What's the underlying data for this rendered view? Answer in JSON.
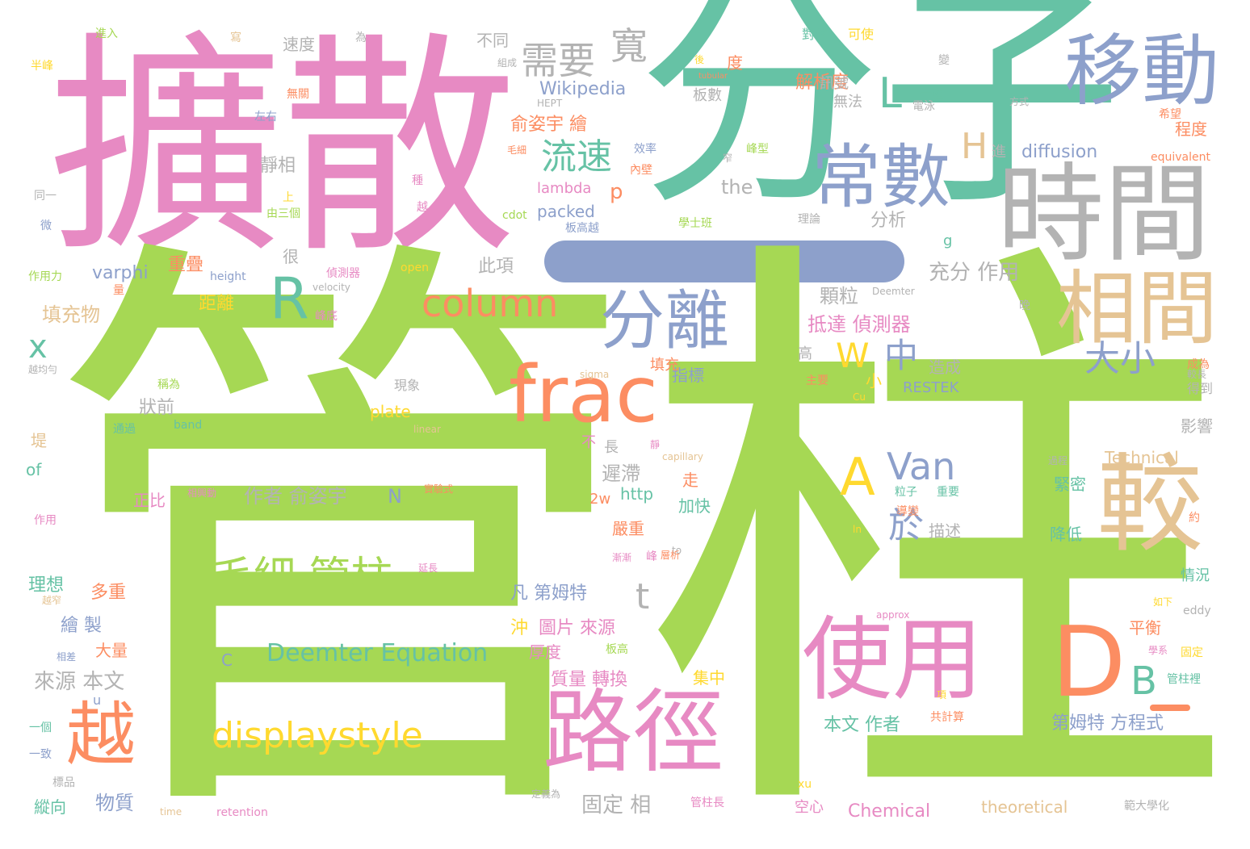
{
  "palette": {
    "green": "#a6d854",
    "teal": "#66c2a5",
    "pink": "#e78ac3",
    "blue": "#8da0cb",
    "orange": "#fc8d62",
    "yellow": "#ffd92f",
    "tan": "#e5c494",
    "gray": "#b3b3b3"
  },
  "words": [
    {
      "text": "擴散",
      "color": "pink"
    },
    {
      "text": "分子",
      "color": "teal"
    },
    {
      "text": "管",
      "color": "green"
    },
    {
      "text": "柱",
      "color": "green"
    },
    {
      "text": "移動",
      "color": "blue"
    },
    {
      "text": "時間",
      "color": "gray"
    },
    {
      "text": "相間",
      "color": "tan"
    },
    {
      "text": "較",
      "color": "tan"
    },
    {
      "text": "常數",
      "color": "blue"
    },
    {
      "text": "分離",
      "color": "blue"
    },
    {
      "text": "frac",
      "color": "orange"
    },
    {
      "text": "使用",
      "color": "pink"
    },
    {
      "text": "路徑",
      "color": "pink"
    },
    {
      "text": "越",
      "color": "orange"
    },
    {
      "text": "D",
      "color": "orange"
    },
    {
      "text": "A",
      "color": "yellow"
    },
    {
      "text": "R",
      "color": "teal"
    },
    {
      "text": "column",
      "color": "orange"
    },
    {
      "text": "需要",
      "color": "gray"
    },
    {
      "text": "寬",
      "color": "gray"
    },
    {
      "text": "L",
      "color": "teal"
    },
    {
      "text": "流速",
      "color": "teal"
    },
    {
      "text": "Van",
      "color": "blue"
    },
    {
      "text": "W",
      "color": "yellow"
    },
    {
      "text": "中",
      "color": "blue"
    },
    {
      "text": "大小",
      "color": "blue"
    },
    {
      "text": "於",
      "color": "blue"
    },
    {
      "text": "B",
      "color": "teal"
    },
    {
      "text": "H",
      "color": "tan"
    },
    {
      "text": "毛細 管柱",
      "color": "green"
    },
    {
      "text": "displaystyle",
      "color": "yellow"
    },
    {
      "text": "Deemter Equation",
      "color": "teal"
    },
    {
      "text": "t",
      "color": "gray"
    },
    {
      "text": "x",
      "color": "teal"
    },
    {
      "text": "解析度",
      "color": "orange"
    },
    {
      "text": "俞姿宇 繪",
      "color": "orange"
    },
    {
      "text": "Wikipedia",
      "color": "blue"
    },
    {
      "text": "靜相",
      "color": "gray"
    },
    {
      "text": "分析",
      "color": "gray"
    },
    {
      "text": "the",
      "color": "gray"
    },
    {
      "text": "diffusion",
      "color": "blue"
    },
    {
      "text": "lambda",
      "color": "pink"
    },
    {
      "text": "packed",
      "color": "blue"
    },
    {
      "text": "p",
      "color": "orange"
    },
    {
      "text": "充分 作用",
      "color": "gray"
    },
    {
      "text": "抵達 偵測器",
      "color": "pink"
    },
    {
      "text": "顆粒",
      "color": "gray"
    },
    {
      "text": "填充物",
      "color": "tan"
    },
    {
      "text": "varphi",
      "color": "blue"
    },
    {
      "text": "重疊",
      "color": "orange"
    },
    {
      "text": "此項",
      "color": "gray"
    },
    {
      "text": "距離",
      "color": "yellow"
    },
    {
      "text": "狀前",
      "color": "gray"
    },
    {
      "text": "遲滯",
      "color": "gray"
    },
    {
      "text": "作者 俞姿宇",
      "color": "gray"
    },
    {
      "text": "N",
      "color": "blue"
    },
    {
      "text": "正比",
      "color": "pink"
    },
    {
      "text": "plate",
      "color": "yellow"
    },
    {
      "text": "http",
      "color": "teal"
    },
    {
      "text": "2w",
      "color": "orange"
    },
    {
      "text": "多重",
      "color": "orange"
    },
    {
      "text": "理想",
      "color": "teal"
    },
    {
      "text": "繪 製",
      "color": "blue"
    },
    {
      "text": "大量",
      "color": "orange"
    },
    {
      "text": "來源 本文",
      "color": "gray"
    },
    {
      "text": "物質",
      "color": "blue"
    },
    {
      "text": "C",
      "color": "blue"
    },
    {
      "text": "凡 第姆特",
      "color": "blue"
    },
    {
      "text": "圖片 來源",
      "color": "pink"
    },
    {
      "text": "沖",
      "color": "yellow"
    },
    {
      "text": "厚度",
      "color": "pink"
    },
    {
      "text": "質量 轉換",
      "color": "pink"
    },
    {
      "text": "固定 相",
      "color": "gray"
    },
    {
      "text": "Chemical",
      "color": "pink"
    },
    {
      "text": "本文 作者",
      "color": "teal"
    },
    {
      "text": "第姆特 方程式",
      "color": "blue"
    },
    {
      "text": "theoretical",
      "color": "tan"
    },
    {
      "text": "集中",
      "color": "yellow"
    },
    {
      "text": "平衡",
      "color": "orange"
    },
    {
      "text": "降低",
      "color": "teal"
    },
    {
      "text": "緊密",
      "color": "teal"
    },
    {
      "text": "描述",
      "color": "gray"
    },
    {
      "text": "情況",
      "color": "teal"
    },
    {
      "text": "影響",
      "color": "gray"
    },
    {
      "text": "Technical",
      "color": "tan"
    },
    {
      "text": "RESTEK",
      "color": "blue"
    },
    {
      "text": "造成",
      "color": "gray"
    },
    {
      "text": "指標",
      "color": "blue"
    },
    {
      "text": "填充",
      "color": "orange"
    },
    {
      "text": "程度",
      "color": "orange"
    },
    {
      "text": "equivalent",
      "color": "orange"
    },
    {
      "text": "得到",
      "color": "gray"
    },
    {
      "text": "加快",
      "color": "teal"
    },
    {
      "text": "走",
      "color": "orange"
    },
    {
      "text": "嚴重",
      "color": "orange"
    },
    {
      "text": "速度",
      "color": "gray"
    },
    {
      "text": "不同",
      "color": "gray"
    },
    {
      "text": "很",
      "color": "gray"
    },
    {
      "text": "小",
      "color": "yellow"
    },
    {
      "text": "高",
      "color": "gray"
    },
    {
      "text": "無法",
      "color": "gray"
    },
    {
      "text": "訊號",
      "color": "gray"
    },
    {
      "text": "板數",
      "color": "gray"
    },
    {
      "text": "度",
      "color": "orange"
    },
    {
      "text": "可使",
      "color": "yellow"
    },
    {
      "text": "對稱",
      "color": "teal"
    },
    {
      "text": "進入",
      "color": "green"
    },
    {
      "text": "半峰",
      "color": "yellow"
    },
    {
      "text": "左右",
      "color": "blue"
    },
    {
      "text": "同一",
      "color": "gray"
    },
    {
      "text": "作用力",
      "color": "green"
    },
    {
      "text": "越均勻",
      "color": "gray"
    },
    {
      "text": "of",
      "color": "teal"
    },
    {
      "text": "堤",
      "color": "tan"
    },
    {
      "text": "作用",
      "color": "pink"
    },
    {
      "text": "一致",
      "color": "blue"
    },
    {
      "text": "一個",
      "color": "teal"
    },
    {
      "text": "縱向",
      "color": "teal"
    },
    {
      "text": "標品",
      "color": "gray"
    },
    {
      "text": "不",
      "color": "pink"
    },
    {
      "text": "長",
      "color": "gray"
    },
    {
      "text": "現象",
      "color": "gray"
    },
    {
      "text": "cdot",
      "color": "green"
    },
    {
      "text": "open",
      "color": "yellow"
    },
    {
      "text": "height",
      "color": "blue"
    },
    {
      "text": "velocity",
      "color": "gray"
    },
    {
      "text": "sigma",
      "color": "tan"
    },
    {
      "text": "Cu",
      "color": "yellow"
    },
    {
      "text": "linear",
      "color": "tan"
    },
    {
      "text": "band",
      "color": "teal"
    },
    {
      "text": "capillary",
      "color": "tan"
    },
    {
      "text": "approx",
      "color": "pink"
    },
    {
      "text": "to",
      "color": "gray"
    },
    {
      "text": "ln",
      "color": "yellow"
    },
    {
      "text": "eddy",
      "color": "gray"
    },
    {
      "text": "time",
      "color": "tan"
    },
    {
      "text": "retention",
      "color": "pink"
    },
    {
      "text": "tubular",
      "color": "orange"
    },
    {
      "text": "HEPT",
      "color": "gray"
    },
    {
      "text": "Deemter",
      "color": "gray"
    },
    {
      "text": "u",
      "color": "blue"
    },
    {
      "text": "g",
      "color": "teal"
    },
    {
      "text": "空心",
      "color": "pink"
    },
    {
      "text": "xu",
      "color": "yellow"
    },
    {
      "text": "約",
      "color": "orange"
    },
    {
      "text": "較長",
      "color": "gray"
    },
    {
      "text": "成為",
      "color": "orange"
    },
    {
      "text": "方式",
      "color": "gray"
    },
    {
      "text": "希望",
      "color": "orange"
    },
    {
      "text": "一種",
      "color": "teal"
    },
    {
      "text": "理論",
      "color": "gray"
    },
    {
      "text": "學士班",
      "color": "green"
    },
    {
      "text": "板高越",
      "color": "blue"
    },
    {
      "text": "峰型",
      "color": "green"
    },
    {
      "text": "內壁",
      "color": "orange"
    },
    {
      "text": "效率",
      "color": "blue"
    },
    {
      "text": "電泳",
      "color": "gray"
    },
    {
      "text": "組成",
      "color": "gray"
    },
    {
      "text": "無關",
      "color": "orange"
    },
    {
      "text": "管柱長",
      "color": "pink"
    },
    {
      "text": "定義為",
      "color": "gray"
    },
    {
      "text": "範大學化",
      "color": "gray"
    },
    {
      "text": "管柱裡",
      "color": "teal"
    },
    {
      "text": "固定",
      "color": "yellow"
    },
    {
      "text": "學系",
      "color": "pink"
    },
    {
      "text": "共計算",
      "color": "orange"
    },
    {
      "text": "項",
      "color": "yellow"
    },
    {
      "text": "重要",
      "color": "teal"
    },
    {
      "text": "過程",
      "color": "gray"
    },
    {
      "text": "如下",
      "color": "yellow"
    },
    {
      "text": "實驗式",
      "color": "orange"
    },
    {
      "text": "相興動",
      "color": "pink"
    },
    {
      "text": "峰底",
      "color": "pink"
    },
    {
      "text": "偵測器",
      "color": "pink"
    },
    {
      "text": "層析",
      "color": "orange"
    },
    {
      "text": "漸漸",
      "color": "pink"
    },
    {
      "text": "板高",
      "color": "green"
    },
    {
      "text": "峰",
      "color": "pink"
    },
    {
      "text": "延長",
      "color": "pink"
    },
    {
      "text": "粒子",
      "color": "teal"
    },
    {
      "text": "由三個",
      "color": "green"
    },
    {
      "text": "上",
      "color": "yellow"
    },
    {
      "text": "稱為",
      "color": "green"
    },
    {
      "text": "主要",
      "color": "orange"
    },
    {
      "text": "進",
      "color": "gray"
    },
    {
      "text": "毛細",
      "color": "orange"
    },
    {
      "text": "窄",
      "color": "gray"
    },
    {
      "text": "後",
      "color": "yellow"
    },
    {
      "text": "變",
      "color": "gray"
    },
    {
      "text": "為",
      "color": "gray"
    },
    {
      "text": "微",
      "color": "blue"
    },
    {
      "text": "種",
      "color": "pink"
    },
    {
      "text": "越",
      "color": "pink"
    },
    {
      "text": "量",
      "color": "orange"
    },
    {
      "text": "靜",
      "color": "pink"
    },
    {
      "text": "晚",
      "color": "gray"
    },
    {
      "text": "導變",
      "color": "orange"
    },
    {
      "text": "寫",
      "color": "tan"
    },
    {
      "text": "相差",
      "color": "blue"
    },
    {
      "text": "通過",
      "color": "teal"
    },
    {
      "text": "越窄",
      "color": "tan"
    }
  ]
}
